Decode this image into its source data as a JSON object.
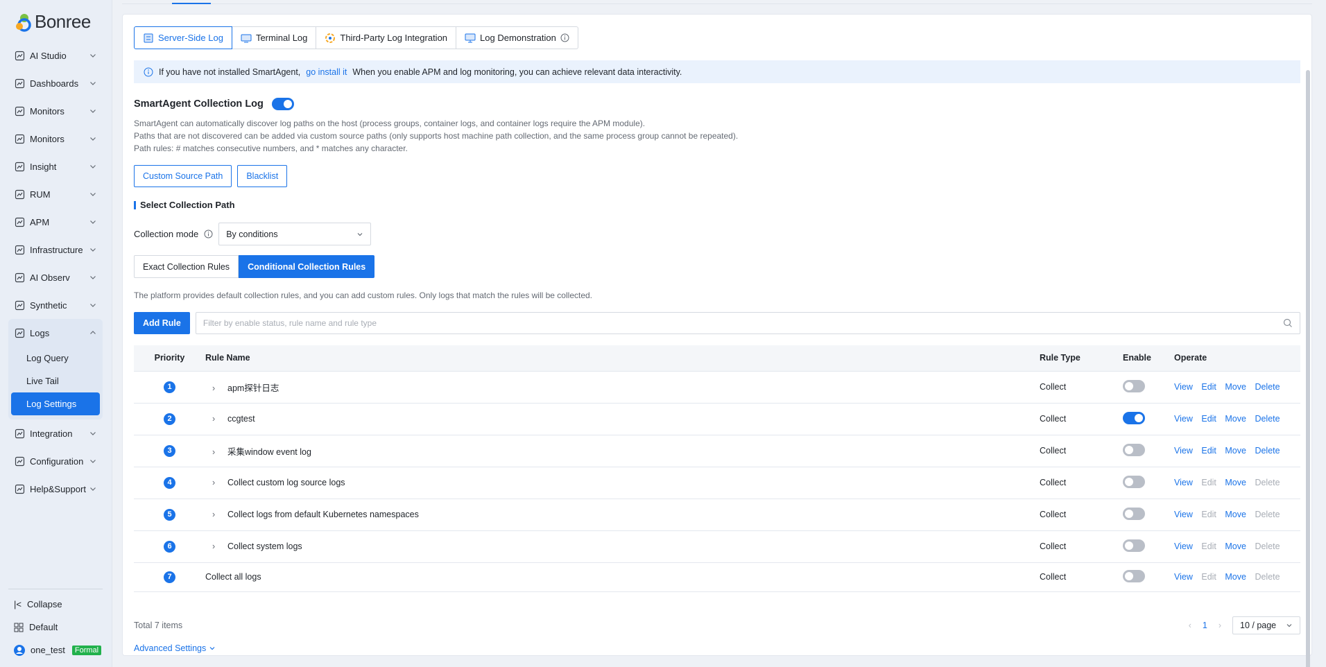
{
  "brand": {
    "logo_text": "Bonree",
    "accent": "#1a73e8"
  },
  "sidebar": {
    "items": [
      {
        "label": "AI Studio",
        "icon": "ai-studio-icon"
      },
      {
        "label": "Dashboards",
        "icon": "dashboard-icon"
      },
      {
        "label": "Monitors",
        "icon": "monitor-icon"
      },
      {
        "label": "Monitors",
        "icon": "monitor-icon"
      },
      {
        "label": "Insight",
        "icon": "insight-icon"
      },
      {
        "label": "RUM",
        "icon": "rum-icon"
      },
      {
        "label": "APM",
        "icon": "apm-icon"
      },
      {
        "label": "Infrastructure",
        "icon": "infrastructure-icon"
      },
      {
        "label": "AI Observ",
        "icon": "ai-observ-icon"
      },
      {
        "label": "Synthetic",
        "icon": "synthetic-icon"
      }
    ],
    "logs": {
      "label": "Logs",
      "sub": [
        "Log Query",
        "Live Tail",
        "Log Settings"
      ],
      "active_sub": "Log Settings"
    },
    "items_after": [
      {
        "label": "Integration",
        "icon": "integration-icon"
      },
      {
        "label": "Configuration",
        "icon": "configuration-icon"
      },
      {
        "label": "Help&Support",
        "icon": "help-icon"
      }
    ],
    "bottom": {
      "collapse": "Collapse",
      "workspace": "Default",
      "user": "one_test",
      "badge": "Formal"
    }
  },
  "tabs": [
    {
      "label": "Server-Side Log",
      "active": true
    },
    {
      "label": "Terminal Log"
    },
    {
      "label": "Third-Party Log Integration"
    },
    {
      "label": "Log Demonstration"
    }
  ],
  "info": {
    "before": "If you have not installed SmartAgent,",
    "link": "go install it",
    "after": "When you enable APM and log monitoring, you can achieve relevant data interactivity."
  },
  "smartagent": {
    "title": "SmartAgent Collection Log",
    "enabled": true,
    "desc_1": "SmartAgent can automatically discover log paths on the host (process groups, container logs, and container logs require the APM module).",
    "desc_2": "Paths that are not discovered can be added via custom source paths (only supports host machine path collection, and the same process group cannot be repeated).",
    "desc_3": "Path rules: # matches consecutive numbers, and * matches any character."
  },
  "buttons": {
    "custom_source": "Custom Source Path",
    "blacklist": "Blacklist",
    "add_rule": "Add Rule"
  },
  "section": {
    "title": "Select Collection Path"
  },
  "mode": {
    "label": "Collection mode",
    "value": "By conditions"
  },
  "segments": {
    "exact": "Exact Collection Rules",
    "conditional": "Conditional Collection Rules"
  },
  "platform_note": "The platform provides default collection rules, and you can add custom rules. Only logs that match the rules will be collected.",
  "search": {
    "placeholder": "Filter by enable status, rule name and rule type"
  },
  "table": {
    "headers": {
      "priority": "Priority",
      "name": "Rule Name",
      "type": "Rule Type",
      "enable": "Enable",
      "operate": "Operate"
    },
    "ops": {
      "view": "View",
      "edit": "Edit",
      "move": "Move",
      "delete": "Delete"
    },
    "rows": [
      {
        "priority": "1",
        "name": "apm探针日志",
        "type": "Collect",
        "enabled": false,
        "expandable": true,
        "editable": true
      },
      {
        "priority": "2",
        "name": "ccgtest",
        "type": "Collect",
        "enabled": true,
        "expandable": true,
        "editable": true
      },
      {
        "priority": "3",
        "name": "采集window event log",
        "type": "Collect",
        "enabled": false,
        "expandable": true,
        "editable": true
      },
      {
        "priority": "4",
        "name": "Collect custom log source logs",
        "type": "Collect",
        "enabled": false,
        "expandable": true,
        "editable": false
      },
      {
        "priority": "5",
        "name": "Collect logs from default Kubernetes namespaces",
        "type": "Collect",
        "enabled": false,
        "expandable": true,
        "editable": false
      },
      {
        "priority": "6",
        "name": "Collect system logs",
        "type": "Collect",
        "enabled": false,
        "expandable": true,
        "editable": false
      },
      {
        "priority": "7",
        "name": "Collect all logs",
        "type": "Collect",
        "enabled": false,
        "expandable": false,
        "editable": false
      }
    ]
  },
  "footer": {
    "total": "Total 7 items",
    "page": "1",
    "page_size": "10 / page"
  },
  "advanced": "Advanced Settings"
}
